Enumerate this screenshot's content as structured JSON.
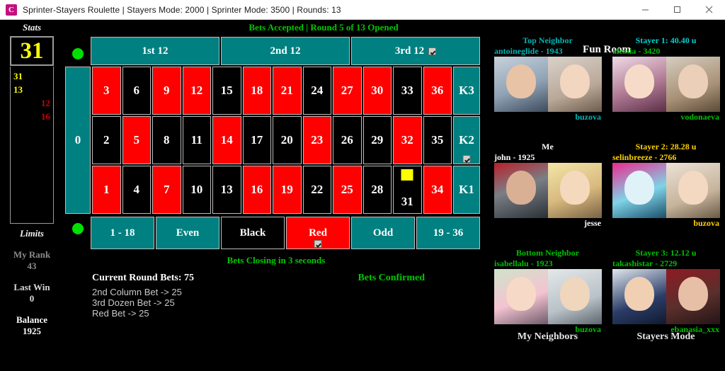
{
  "window": {
    "icon": "app-icon",
    "icon_letter": "C",
    "title": "Sprinter-Stayers Roulette | Stayers Mode: 2000 | Sprinter Mode: 3500 | Rounds: 13",
    "minimize_label": "minimize-icon",
    "maximize_label": "maximize-icon",
    "close_label": "close-icon"
  },
  "status": {
    "header": "Bets Accepted | Round 5 of 13 Opened",
    "header_color": "#00c800",
    "closing": "Bets Closing in 3 seconds",
    "confirmed": "Bets Confirmed"
  },
  "stats": {
    "label": "Stats",
    "last_number": "31",
    "hot": [
      "31",
      "13"
    ],
    "cold": [
      "12",
      "16"
    ],
    "hot_color": "#ffff00",
    "cold_color": "#cc0000"
  },
  "limits": {
    "label": "Limits",
    "my_rank_label": "My Rank",
    "my_rank_value": "43",
    "last_win_label": "Last Win",
    "last_win_value": "0",
    "balance_label": "Balance",
    "balance_value": "1925"
  },
  "board": {
    "zero": "0",
    "dozens": [
      {
        "label": "1st 12",
        "selected": false
      },
      {
        "label": "2nd 12",
        "selected": false
      },
      {
        "label": "3rd 12",
        "selected": true
      }
    ],
    "rows": [
      {
        "cells": [
          {
            "n": "3",
            "color": "red"
          },
          {
            "n": "6",
            "color": "black"
          },
          {
            "n": "9",
            "color": "red"
          },
          {
            "n": "12",
            "color": "red"
          },
          {
            "n": "15",
            "color": "black"
          },
          {
            "n": "18",
            "color": "red"
          },
          {
            "n": "21",
            "color": "red"
          },
          {
            "n": "24",
            "color": "black"
          },
          {
            "n": "27",
            "color": "red"
          },
          {
            "n": "30",
            "color": "red"
          },
          {
            "n": "33",
            "color": "black"
          },
          {
            "n": "36",
            "color": "red"
          }
        ],
        "column": {
          "label": "K3",
          "selected": false
        }
      },
      {
        "cells": [
          {
            "n": "2",
            "color": "black"
          },
          {
            "n": "5",
            "color": "red"
          },
          {
            "n": "8",
            "color": "black"
          },
          {
            "n": "11",
            "color": "black"
          },
          {
            "n": "14",
            "color": "red"
          },
          {
            "n": "17",
            "color": "black"
          },
          {
            "n": "20",
            "color": "black"
          },
          {
            "n": "23",
            "color": "red"
          },
          {
            "n": "26",
            "color": "black"
          },
          {
            "n": "29",
            "color": "black"
          },
          {
            "n": "32",
            "color": "red"
          },
          {
            "n": "35",
            "color": "black"
          }
        ],
        "column": {
          "label": "K2",
          "selected": true
        }
      },
      {
        "cells": [
          {
            "n": "1",
            "color": "red"
          },
          {
            "n": "4",
            "color": "black"
          },
          {
            "n": "7",
            "color": "red"
          },
          {
            "n": "10",
            "color": "black"
          },
          {
            "n": "13",
            "color": "black"
          },
          {
            "n": "16",
            "color": "red"
          },
          {
            "n": "19",
            "color": "red"
          },
          {
            "n": "22",
            "color": "black"
          },
          {
            "n": "25",
            "color": "red"
          },
          {
            "n": "28",
            "color": "black"
          },
          {
            "n": "31",
            "color": "black",
            "chip": true
          },
          {
            "n": "34",
            "color": "red"
          }
        ],
        "column": {
          "label": "K1",
          "selected": false
        }
      }
    ],
    "outside": [
      {
        "label": "1 - 18",
        "style": "teal",
        "selected": false
      },
      {
        "label": "Even",
        "style": "teal",
        "selected": false
      },
      {
        "label": "Black",
        "style": "black",
        "selected": false
      },
      {
        "label": "Red",
        "style": "red",
        "selected": true
      },
      {
        "label": "Odd",
        "style": "teal",
        "selected": false
      },
      {
        "label": "19 - 36",
        "style": "teal",
        "selected": false
      }
    ],
    "colors": {
      "teal": "#008080",
      "red": "#ff0000",
      "black": "#000000",
      "dot": "#00e000"
    }
  },
  "bets": {
    "title": "Current Round Bets: 75",
    "items": [
      "2nd Column Bet -> 25",
      "3rd Dozen Bet -> 25",
      "Red Bet -> 25"
    ]
  },
  "rightpanel": {
    "room_title": "Fun Room",
    "left_column_label": "My Neighbors",
    "right_column_label": "Stayers Mode",
    "neighbors": [
      {
        "heading": "Top Neighbor",
        "heading_color": "#00b5b5",
        "user": "antoineglide  -  1943",
        "user_color": "#00b5b5",
        "partner": "buzova",
        "partner_color": "#00b5b5"
      },
      {
        "heading": "Me",
        "heading_color": "#ffffff",
        "user": "john - 1925",
        "user_color": "#ffffff",
        "partner": "jesse",
        "partner_color": "#ffffff"
      },
      {
        "heading": "Bottom Neighbor",
        "heading_color": "#00c000",
        "user": "isabellalu  -  1923",
        "user_color": "#00c000",
        "partner": "buzova",
        "partner_color": "#00c000"
      }
    ],
    "stayers": [
      {
        "heading": "Stayer 1: 40.40 u",
        "heading_color": "#00d0d0",
        "user": "alessia  -  3420",
        "user_color": "#00c000",
        "partner": "vodonaeva",
        "partner_color": "#00c000"
      },
      {
        "heading": "Stayer 2: 28.28 u",
        "heading_color": "#ffd000",
        "user": "selinbreeze  -  2766",
        "user_color": "#ffd000",
        "partner": "buzova",
        "partner_color": "#ffd000"
      },
      {
        "heading": "Stayer 3: 12.12 u",
        "heading_color": "#00c000",
        "user": "takashistar  -  2729",
        "user_color": "#00c000",
        "partner": "ebanasia_xxx",
        "partner_color": "#00c000"
      }
    ]
  }
}
